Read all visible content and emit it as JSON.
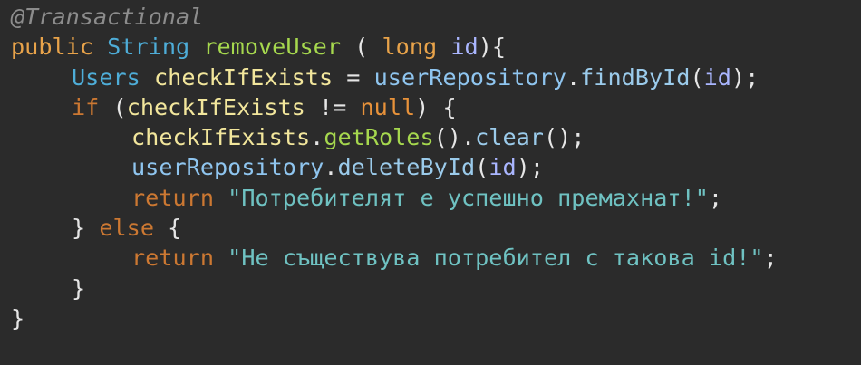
{
  "code": {
    "line1": {
      "annotation": "@Transactional"
    },
    "line2": {
      "kw_public": "public",
      "sp1": " ",
      "type_string": "String",
      "sp2": " ",
      "method_name": "removeUser",
      "sp3": " ",
      "paren_open": "( ",
      "kw_long": "long",
      "sp4": " ",
      "param_id": "id",
      "close": "){"
    },
    "line3": {
      "type_users": "Users",
      "sp1": " ",
      "var_check": "checkIfExists",
      "assign": " = ",
      "repo": "userRepository",
      "dot": ".",
      "method_find": "findById",
      "paren_open": "(",
      "arg": "id",
      "paren_close": ");"
    },
    "line4": {
      "kw_if": "if",
      "paren_open": " (",
      "var_check": "checkIfExists",
      "op": " != ",
      "null_kw": "null",
      "close": ") {"
    },
    "line5": {
      "var_check": "checkIfExists",
      "dot1": ".",
      "method_get": "getRoles",
      "mid": "().",
      "method_clear": "clear",
      "close": "();"
    },
    "line6": {
      "repo": "userRepository",
      "dot": ".",
      "method_delete": "deleteById",
      "paren_open": "(",
      "arg": "id",
      "close": ");"
    },
    "line7": {
      "kw_return": "return",
      "sp": " ",
      "string": "\"Потребителят е успешно премахнат!\"",
      "semi": ";"
    },
    "line8": {
      "brace": "}",
      "sp": " ",
      "kw_else": "else",
      "open": " {"
    },
    "line9": {
      "kw_return": "return",
      "sp": " ",
      "string": "\"Не съществува потребител с такова id!\"",
      "semi": ";"
    },
    "line10": {
      "brace": "}"
    },
    "line11": {
      "brace": "}"
    }
  }
}
